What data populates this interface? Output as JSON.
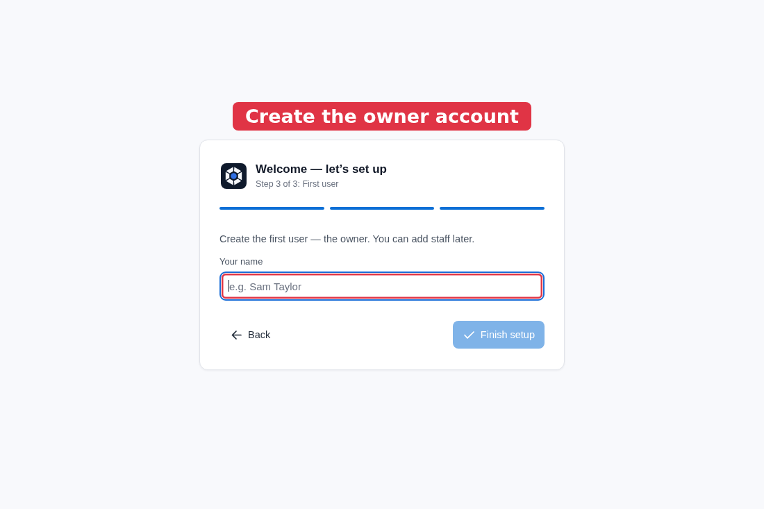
{
  "annotation": {
    "title": "Create the owner account"
  },
  "card": {
    "title": "Welcome — let’s set up",
    "subtitle": "Step 3 of 3: First user",
    "steps": [
      {
        "done": true
      },
      {
        "done": true
      },
      {
        "done": true
      }
    ],
    "description": "Create the first user — the owner. You can add staff later.",
    "field": {
      "label": "Your name",
      "placeholder": "e.g. Sam Taylor",
      "focused": true,
      "highlighted": true
    },
    "buttons": [
      {
        "kind": "back",
        "label": "Back",
        "disabled": false
      },
      {
        "kind": "submit",
        "label": "Finish setup",
        "disabled": true
      }
    ]
  }
}
